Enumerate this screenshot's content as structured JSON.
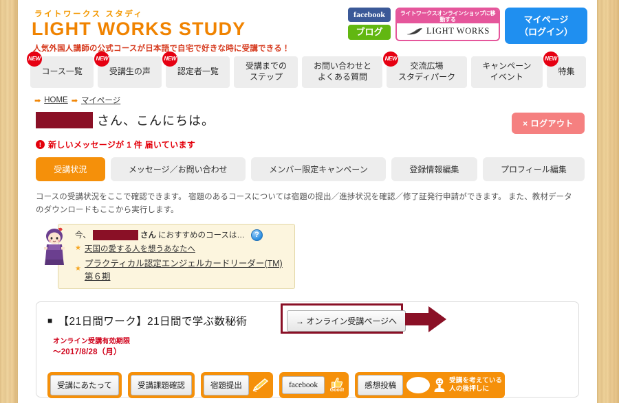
{
  "brand": {
    "kana": "ライトワークス スタディ",
    "name": "LIGHT WORKS STUDY",
    "tagline": "人気外国人講師の公式コースが日本語で自宅で好きな時に受講できる！",
    "accent_orange": "#f08300",
    "accent_red": "#d63a1e"
  },
  "header": {
    "facebook_label": "facebook",
    "blog_label": "ブログ",
    "shop_caption": "ライトワークスオンラインショップに移動する",
    "shop_name": "LIGHT WORKS",
    "mypage_label": "マイページ\n（ログイン）",
    "mypage_color": "#1f8ff0"
  },
  "nav": {
    "new_badge": "NEW",
    "items": [
      {
        "label": "コース一覧",
        "new": true
      },
      {
        "label": "受講生の声",
        "new": true
      },
      {
        "label": "認定者一覧",
        "new": true
      },
      {
        "label": "受講までの\nステップ",
        "new": false
      },
      {
        "label": "お問い合わせと\nよくある質問",
        "new": false
      },
      {
        "label": "交流広場\nスタディパーク",
        "new": true
      },
      {
        "label": "キャンペーン\nイベント",
        "new": false
      },
      {
        "label": "特集",
        "new": true
      }
    ]
  },
  "breadcrumb": {
    "arrow": "➡",
    "items": [
      "HOME",
      "マイページ"
    ]
  },
  "greeting": {
    "redacted_name": "",
    "text": "さん、こんにちは。",
    "logout_label": "× ログアウト",
    "logout_color": "#f58080"
  },
  "notice": {
    "icon": "!",
    "text": "新しいメッセージが 1 件 届いています",
    "color": "#e3000b"
  },
  "tabs": {
    "active_color": "#f5900a",
    "items": [
      {
        "label": "受講状況",
        "active": true
      },
      {
        "label": "メッセージ／お問い合わせ",
        "active": false
      },
      {
        "label": "メンバー限定キャンペーン",
        "active": false
      },
      {
        "label": "登録情報編集",
        "active": false
      },
      {
        "label": "プロフィール編集",
        "active": false
      }
    ]
  },
  "description": "コースの受講状況をここで確認できます。 宿題のあるコースについては宿題の提出／進捗状況を確認／修了証発行申請ができます。 また、教材データのダウンロードもここから実行します。",
  "recommend": {
    "prefix": "今、",
    "san": "さん",
    "suffix": "におすすめのコースは…",
    "help_icon": "?",
    "star": "★",
    "links": [
      "天国の愛する人を想うあなたへ",
      "プラクティカル認定エンジェルカードリーダー(TM) 第６期"
    ]
  },
  "course": {
    "bullet": "■",
    "title": "【21日間ワーク】21日間で学ぶ数秘術",
    "online_button": "→ オンライン受講ページへ",
    "deadline_label": "オンライン受講有効期限",
    "deadline_value": "～2017/8/28（月）",
    "deadline_color": "#d0021b",
    "annotation_color": "#8a1026"
  },
  "actions": [
    {
      "label": "受講にあたって",
      "icon": "none"
    },
    {
      "label": "受講課題確認",
      "icon": "none"
    },
    {
      "label": "宿題提出",
      "icon": "pencil-icon"
    },
    {
      "label": "facebook",
      "icon": "thumbs-up-icon",
      "icon_text": "Good!"
    },
    {
      "label": "感想投稿",
      "icon": "speech-person-icon",
      "note": "受講を考えている\n人の後押しに"
    }
  ]
}
